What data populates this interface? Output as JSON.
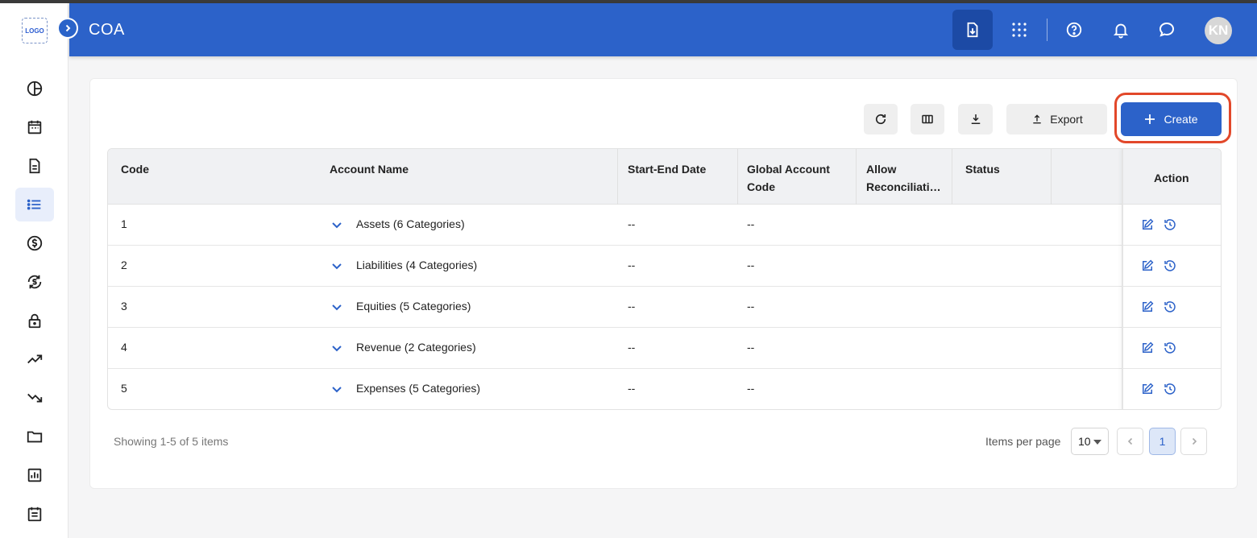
{
  "app": {
    "logo_text": "LOGO",
    "page_title": "COA",
    "avatar_initials": "KN"
  },
  "sidebar": {
    "items": [
      {
        "icon": "pie-chart-icon"
      },
      {
        "icon": "calendar-icon"
      },
      {
        "icon": "document-icon"
      },
      {
        "icon": "list-icon",
        "active": true
      },
      {
        "icon": "dollar-icon"
      },
      {
        "icon": "currency-exchange-icon"
      },
      {
        "icon": "lock-icon"
      },
      {
        "icon": "trending-up-icon"
      },
      {
        "icon": "trending-down-icon"
      },
      {
        "icon": "folder-icon"
      },
      {
        "icon": "report-icon"
      },
      {
        "icon": "notes-icon"
      }
    ]
  },
  "toolbar": {
    "export_label": "Export",
    "create_label": "Create"
  },
  "table": {
    "columns": [
      "Code",
      "Account Name",
      "Start-End Date",
      "Global Account Code",
      "Allow Reconciliati…",
      "Status",
      "Action"
    ],
    "column_lines": {
      "global_1": "Global Account",
      "global_2": "Code",
      "allow_1": "Allow",
      "allow_2": "Reconciliati…"
    },
    "rows": [
      {
        "code": "1",
        "name": "Assets (6 Categories)",
        "date": "--",
        "global_code": "--"
      },
      {
        "code": "2",
        "name": "Liabilities (4 Categories)",
        "date": "--",
        "global_code": "--"
      },
      {
        "code": "3",
        "name": "Equities (5 Categories)",
        "date": "--",
        "global_code": "--"
      },
      {
        "code": "4",
        "name": "Revenue (2 Categories)",
        "date": "--",
        "global_code": "--"
      },
      {
        "code": "5",
        "name": "Expenses (5 Categories)",
        "date": "--",
        "global_code": "--"
      }
    ]
  },
  "footer": {
    "showing": "Showing 1-5 of 5 items",
    "items_per_page_label": "Items per page",
    "items_per_page": "10",
    "current_page": "1"
  },
  "colors": {
    "primary": "#2c62c9",
    "highlight_ring": "#e2482a"
  }
}
